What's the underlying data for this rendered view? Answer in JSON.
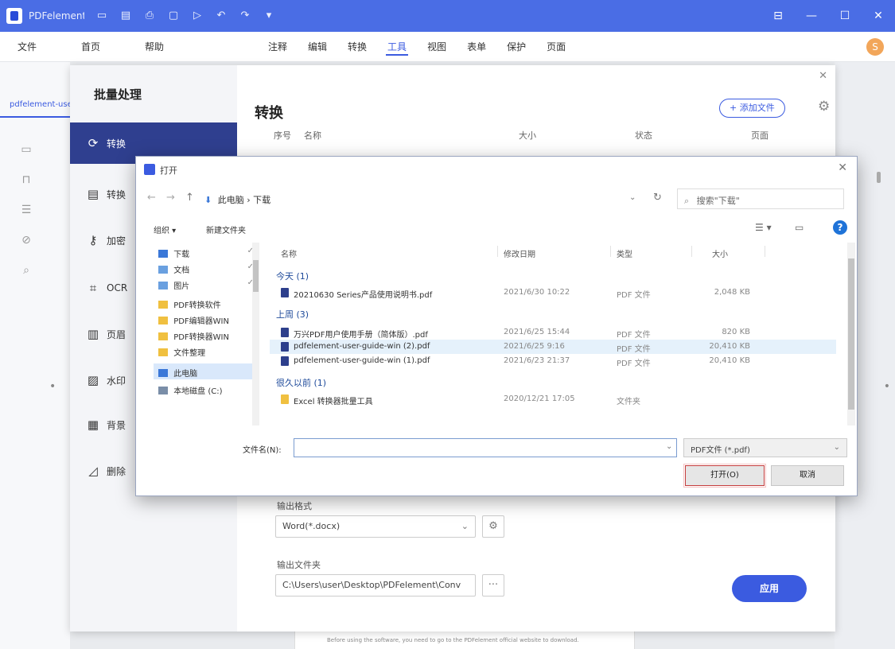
{
  "titlebar": {
    "title": "PDFelement",
    "quick_icons": [
      "▭",
      "▤",
      "⎙",
      "▢",
      "▷",
      "↶",
      "↷",
      "▾"
    ],
    "window_buttons": [
      "⊟",
      "—",
      "☐",
      "✕"
    ]
  },
  "menubar": {
    "left_menu": [
      "文件",
      "首页",
      "帮助"
    ],
    "tabs": [
      "注释",
      "编辑",
      "转换",
      "工具",
      "视图",
      "表单",
      "保护",
      "页面"
    ],
    "active_tab": "工具",
    "avatar": "S"
  },
  "file_tab": "pdfelement-user-guide",
  "batch": {
    "heading": "批量处理",
    "nav": [
      {
        "label": "转换",
        "icon": "⟳"
      },
      {
        "label": "转换",
        "icon": "▤"
      },
      {
        "label": "加密",
        "icon": "⚷"
      },
      {
        "label": "OCR",
        "icon": "⌗"
      },
      {
        "label": "页眉",
        "icon": "▥"
      },
      {
        "label": "水印",
        "icon": "▨"
      },
      {
        "label": "背景",
        "icon": "▦"
      },
      {
        "label": "删除",
        "icon": "◿"
      }
    ],
    "title": "转换",
    "add_files": "+ 添加文件",
    "columns": [
      "序号",
      "名称",
      "大小",
      "状态",
      "页面"
    ],
    "output_format_label": "输出格式",
    "output_format_value": "Word(*.docx)",
    "output_folder_label": "输出文件夹",
    "output_folder_value": "C:\\Users\\user\\Desktop\\PDFelement\\Conv",
    "browse_label": "···",
    "apply_label": "应用"
  },
  "dialog": {
    "title": "打开",
    "address": "此电脑 › 下载",
    "search_placeholder": "搜索\"下载\"",
    "organize": "组织 ▾",
    "new_folder": "新建文件夹",
    "help": "?",
    "tree": [
      {
        "label": "下载",
        "icon_color": "#3b78d8",
        "pinned": true
      },
      {
        "label": "文档",
        "icon_color": "#6aa0e0",
        "pinned": true
      },
      {
        "label": "图片",
        "icon_color": "#6aa0e0",
        "pinned": true
      },
      {
        "label": "PDF转换软件",
        "icon_color": "#f0c040",
        "pinned": false
      },
      {
        "label": "PDF编辑器WIN",
        "icon_color": "#f0c040",
        "pinned": false
      },
      {
        "label": "PDF转换器WIN",
        "icon_color": "#f0c040",
        "pinned": false
      },
      {
        "label": "文件整理",
        "icon_color": "#f0c040",
        "pinned": false
      },
      {
        "label": "此电脑",
        "icon_color": "#3b78d8",
        "pinned": false
      },
      {
        "label": "本地磁盘 (C:)",
        "icon_color": "#7a8ea8",
        "pinned": false
      }
    ],
    "columns": [
      "名称",
      "修改日期",
      "类型",
      "大小"
    ],
    "groups": [
      {
        "label": "今天 (1)",
        "files": [
          {
            "name": "20210630 Series产品使用说明书.pdf",
            "date": "2021/6/30 10:22",
            "type": "PDF 文件",
            "size": "2,048 KB",
            "highlight": false
          }
        ]
      },
      {
        "label": "上周 (3)",
        "files": [
          {
            "name": "万兴PDF用户使用手册（简体版）.pdf",
            "date": "2021/6/25 15:44",
            "type": "PDF 文件",
            "size": "820 KB",
            "highlight": false
          },
          {
            "name": "pdfelement-user-guide-win (2).pdf",
            "date": "2021/6/25 9:16",
            "type": "PDF 文件",
            "size": "20,410 KB",
            "highlight": true
          },
          {
            "name": "pdfelement-user-guide-win (1).pdf",
            "date": "2021/6/23 21:37",
            "type": "PDF 文件",
            "size": "20,410 KB",
            "highlight": false
          }
        ]
      },
      {
        "label": "很久以前 (1)",
        "files": [
          {
            "name": "Excel 转换器批量工具",
            "date": "2020/12/21 17:05",
            "type": "文件夹",
            "size": "",
            "highlight": false
          }
        ]
      }
    ],
    "filename_label": "文件名(N):",
    "filename_value": "",
    "filetype": "PDF文件 (*.pdf)",
    "open_label": "打开(O)",
    "cancel_label": "取消"
  },
  "page_preview_text": "Before using the software, you need to go to the PDFelement official website to download."
}
